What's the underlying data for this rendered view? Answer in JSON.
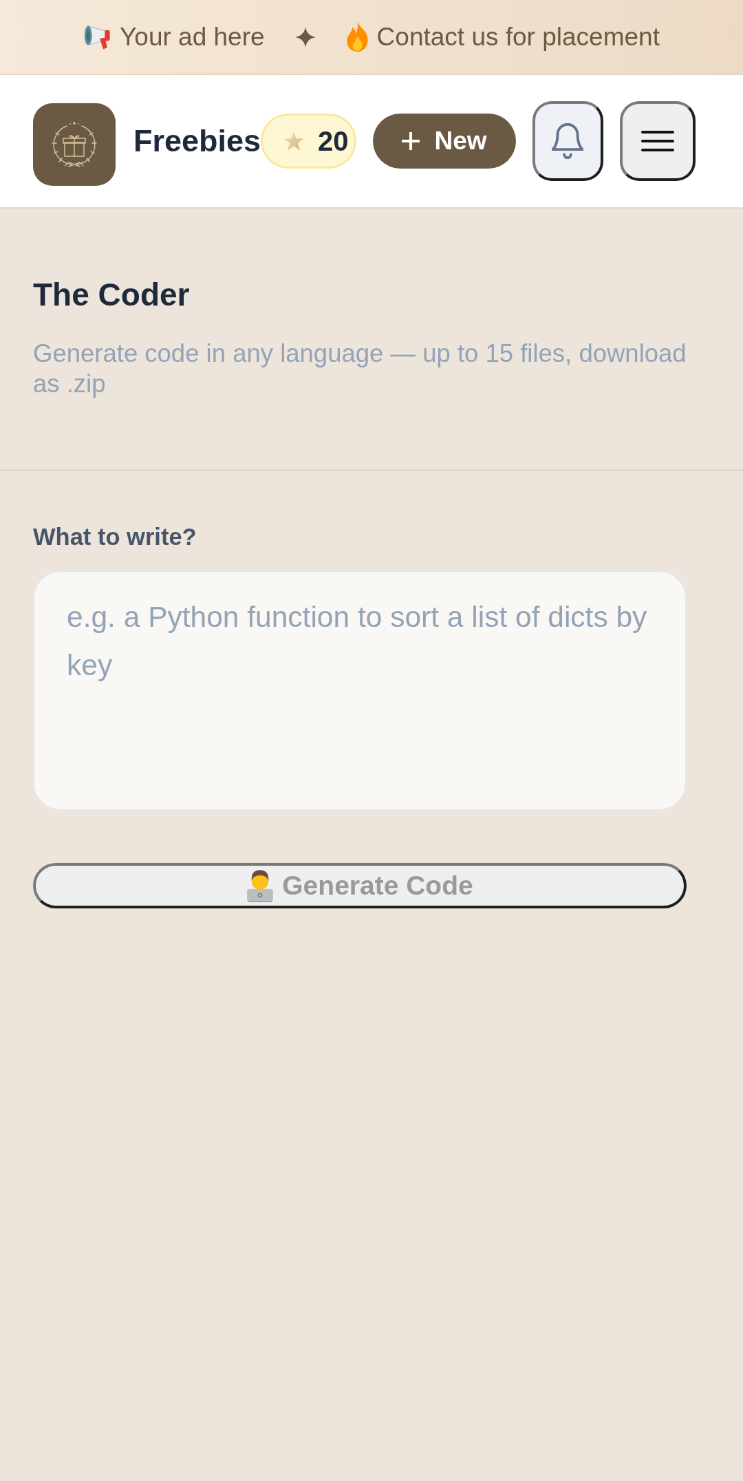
{
  "ad_bar": {
    "promo": "Your ad here",
    "contact": "Contact us for placement"
  },
  "header": {
    "app_name": "Freebies",
    "credits": "20",
    "new_button": "New"
  },
  "tool": {
    "title": "The Coder",
    "subtitle": "Generate code in any language — up to 15 files, download as .zip"
  },
  "form": {
    "label": "What to write?",
    "placeholder": "e.g. a Python function to sort a list of dicts by key",
    "submit": {
      "label": "Generate Code",
      "disabled": true
    }
  }
}
